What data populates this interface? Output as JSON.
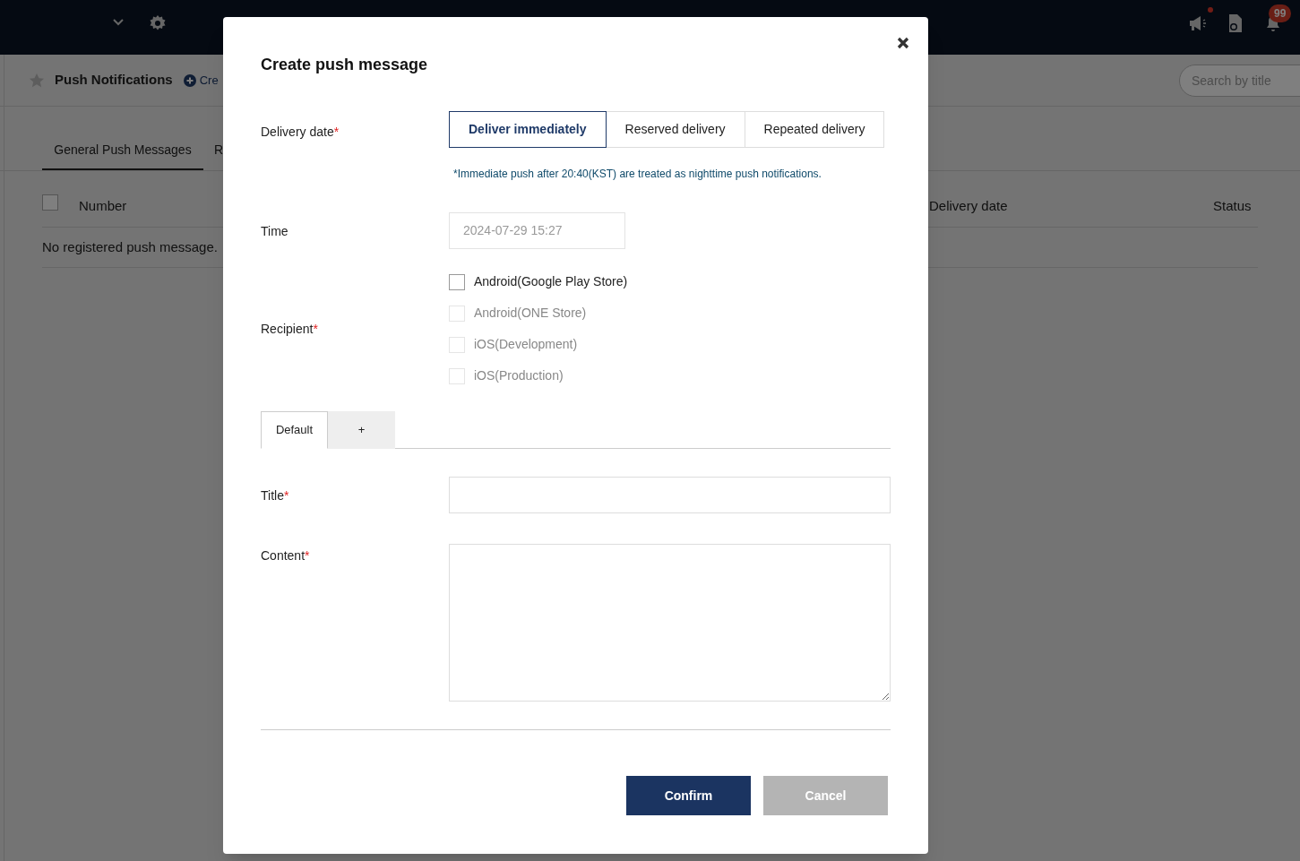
{
  "topbar": {
    "notification_count": "99",
    "announcement_unread": true
  },
  "page": {
    "title": "Push Notifications",
    "create_link": "Cre",
    "search": {
      "placeholder": "Search by title"
    },
    "tabs": [
      {
        "label": "General Push Messages",
        "selected": true
      },
      {
        "label": "R",
        "selected": false
      }
    ],
    "table": {
      "select_all_checked": false,
      "columns": [
        "Number",
        "Delivery date",
        "Status"
      ],
      "empty_text": "No registered push message."
    }
  },
  "dialog": {
    "title": "Create push message",
    "delivery": {
      "label": "Delivery date",
      "required_mark": "*",
      "options": [
        {
          "label": "Deliver immediately",
          "selected": true
        },
        {
          "label": "Reserved delivery",
          "selected": false
        },
        {
          "label": "Repeated delivery",
          "selected": false
        }
      ],
      "note": "*Immediate push after 20:40(KST) are treated as nighttime push notifications."
    },
    "time": {
      "label": "Time",
      "value": "2024-07-29 15:27",
      "disabled": true
    },
    "recipient": {
      "label": "Recipient",
      "required_mark": "*",
      "options": [
        {
          "label": "Android(Google Play Store)",
          "checked": false,
          "disabled": false
        },
        {
          "label": "Android(ONE Store)",
          "checked": false,
          "disabled": true
        },
        {
          "label": "iOS(Development)",
          "checked": false,
          "disabled": true
        },
        {
          "label": "iOS(Production)",
          "checked": false,
          "disabled": true
        }
      ]
    },
    "language_tabs": [
      {
        "label": "Default",
        "selected": true
      },
      {
        "label": "+",
        "selected": false
      }
    ],
    "title_field": {
      "label": "Title",
      "required_mark": "*"
    },
    "content_field": {
      "label": "Content",
      "required_mark": "*"
    },
    "buttons": [
      {
        "label": "Confirm",
        "kind": "primary"
      },
      {
        "label": "Cancel",
        "kind": "secondary"
      }
    ]
  }
}
